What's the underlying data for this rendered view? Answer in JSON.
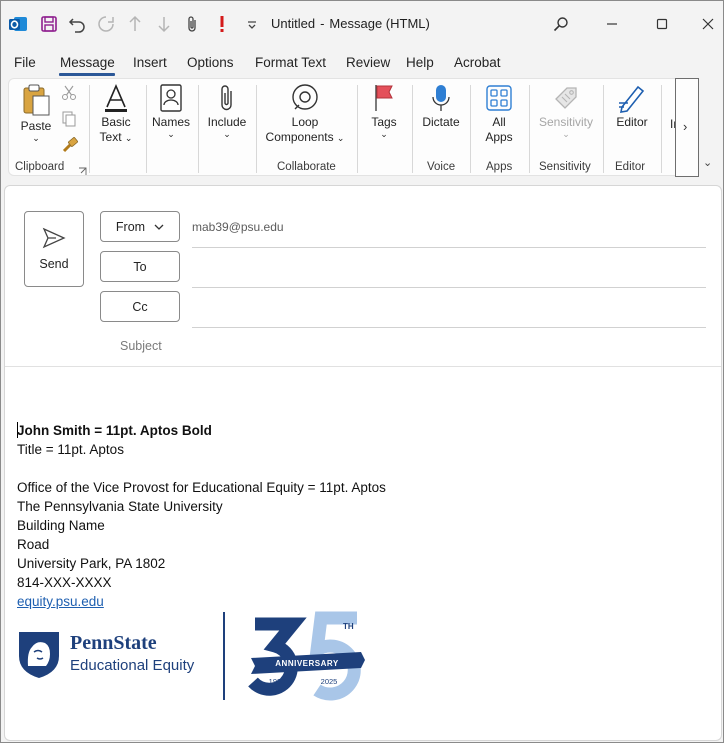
{
  "window": {
    "title": "Untitled",
    "title_sep": "-",
    "title_suffix": "Message (HTML)"
  },
  "menu": {
    "items": [
      "File",
      "Message",
      "Insert",
      "Options",
      "Format Text",
      "Review",
      "Help",
      "Acrobat"
    ],
    "active": "Message"
  },
  "ribbon": {
    "paste": "Paste",
    "basic_text_1": "Basic",
    "basic_text_2": "Text",
    "names": "Names",
    "include": "Include",
    "loop_1": "Loop",
    "loop_2": "Components",
    "tags": "Tags",
    "dictate": "Dictate",
    "all_apps_1": "All",
    "all_apps_2": "Apps",
    "sensitivity": "Sensitivity",
    "editor": "Editor",
    "truncated": "In",
    "groups": {
      "clipboard": "Clipboard",
      "collaborate": "Collaborate",
      "voice": "Voice",
      "apps": "Apps",
      "sensitivity": "Sensitivity",
      "editor": "Editor"
    },
    "more": "›",
    "collapse": "⌄"
  },
  "compose": {
    "send": "Send",
    "from_label": "From",
    "from_address": "mab39@psu.edu",
    "to_label": "To",
    "cc_label": "Cc",
    "subject_placeholder": "Subject"
  },
  "body": {
    "name_line": "John Smith = 11pt. Aptos Bold",
    "title_line": "Title = 11pt. Aptos",
    "office_line": "Office of the Vice Provost for Educational Equity = 11pt. Aptos",
    "university": "The Pennsylvania State University",
    "building": "Building Name",
    "road": "Road",
    "city": "University Park, PA 1802",
    "phone": "814-XXX-XXXX",
    "link": "equity.psu.edu"
  },
  "signature": {
    "ps_name": "PennState",
    "ps_sub": "Educational Equity",
    "anniv_th": "TH",
    "anniv_ribbon": "ANNIVERSARY",
    "anniv_start": "1990",
    "anniv_end": "2025"
  },
  "colors": {
    "accent": "#2b5797",
    "penn_navy": "#1e407c",
    "penn_light": "#a9c6e8",
    "link": "#1e5fb0"
  }
}
